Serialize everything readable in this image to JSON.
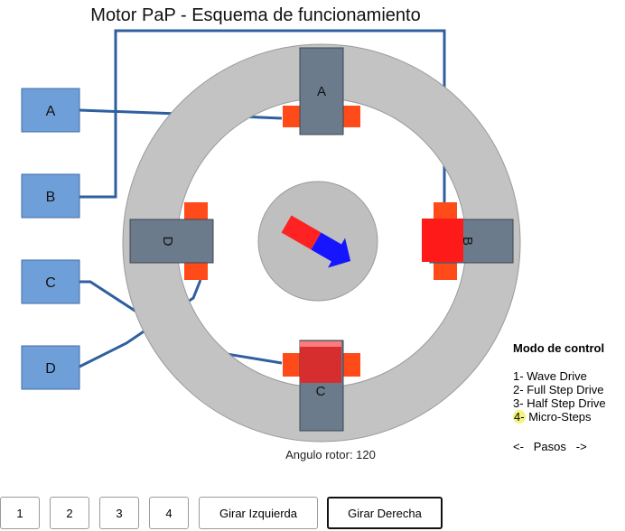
{
  "title": "Motor PaP - Esquema de funcionamiento",
  "coils": [
    {
      "id": "A",
      "label": "A"
    },
    {
      "id": "B",
      "label": "B"
    },
    {
      "id": "C",
      "label": "C"
    },
    {
      "id": "D",
      "label": "D"
    }
  ],
  "poles": {
    "top": "A",
    "right": "B",
    "bottom": "C",
    "left": "D"
  },
  "rotor": {
    "angle_label": "Angulo rotor: 120",
    "angle_deg": 120
  },
  "control": {
    "title": "Modo de control",
    "modes": [
      {
        "num": "1-",
        "label": "Wave Drive"
      },
      {
        "num": "2-",
        "label": "Full Step Drive"
      },
      {
        "num": "3-",
        "label": "Half Step Drive"
      },
      {
        "num": "4-",
        "label": "Micro-Steps"
      }
    ],
    "active_mode": 4,
    "steps_prev": "<-",
    "steps_label": "Pasos",
    "steps_next": "->"
  },
  "buttons": {
    "b1": "1",
    "b2": "2",
    "b3": "3",
    "b4": "4",
    "left": "Girar Izquierda",
    "right": "Girar Derecha"
  },
  "colors": {
    "coil_box": "#6f9fd8",
    "stator_ring": "#c8c8c8",
    "pole": "#6b7b8c",
    "wire": "#2f5f9f",
    "tooth_on": "#ff1a1a",
    "tooth_off": "#ff4a1a",
    "magnet_north": "#1515ff",
    "magnet_south": "#ff2222",
    "highlight": "#f4f47a"
  }
}
